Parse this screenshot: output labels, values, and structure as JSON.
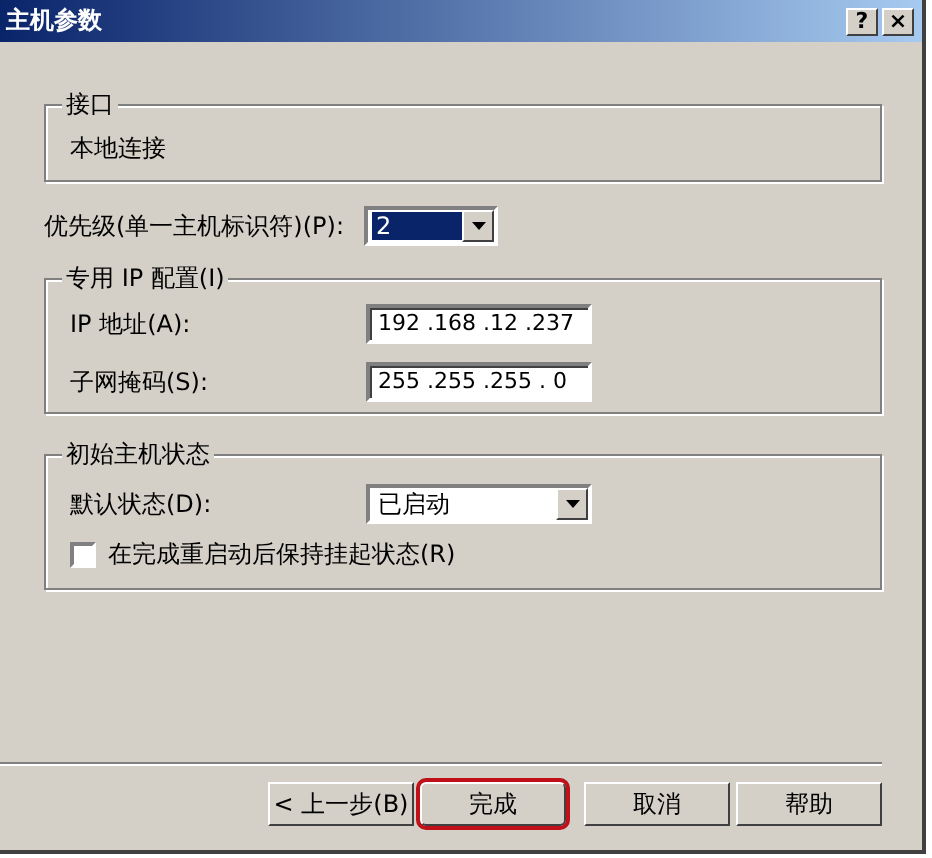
{
  "window": {
    "title": "主机参数",
    "controls": [
      "?",
      "×"
    ]
  },
  "interface_group": {
    "title": "接口",
    "value": "本地连接"
  },
  "priority": {
    "label": "优先级(单一主机标识符)(P):",
    "value": "2"
  },
  "ip_group": {
    "title": "专用 IP 配置(I)",
    "fields": [
      {
        "label": "IP 地址(A):",
        "value": "192 .168 .12 .237"
      },
      {
        "label": "子网掩码(S):",
        "value": "255 .255 .255 . 0"
      }
    ]
  },
  "state_group": {
    "title": "初始主机状态",
    "default_state": {
      "label": "默认状态(D):",
      "value": "已启动"
    },
    "checkbox": {
      "label": "在完成重启动后保持挂起状态(R)",
      "checked": false
    }
  },
  "buttons": [
    {
      "label": "< 上一步(B)",
      "highlighted": false
    },
    {
      "label": "完成",
      "highlighted": true
    },
    {
      "label": "取消",
      "highlighted": false
    },
    {
      "label": "帮助",
      "highlighted": false
    }
  ]
}
